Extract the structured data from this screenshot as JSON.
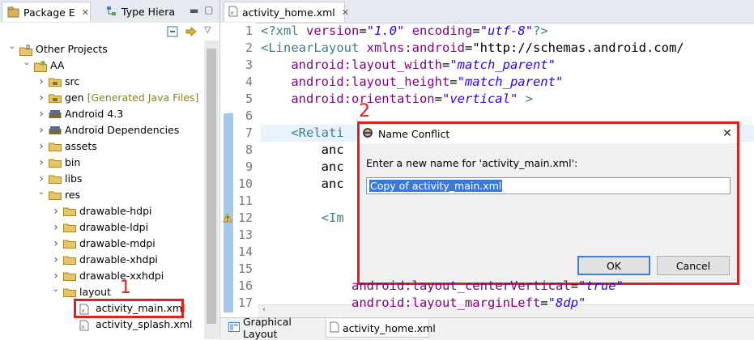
{
  "left_panel": {
    "tabs": [
      {
        "label": "Package E",
        "active": true
      },
      {
        "label": "Type Hiera",
        "active": false
      }
    ],
    "tree": [
      {
        "label": "Other Projects",
        "depth": 0,
        "expanded": true,
        "icon": "working-set-icon"
      },
      {
        "label": "AA",
        "depth": 1,
        "expanded": true,
        "icon": "android-project-icon"
      },
      {
        "label": "src",
        "depth": 2,
        "expanded": false,
        "icon": "source-folder-icon"
      },
      {
        "label": "gen",
        "suffix": "[Generated Java Files]",
        "depth": 2,
        "expanded": false,
        "icon": "source-folder-icon"
      },
      {
        "label": "Android 4.3",
        "depth": 2,
        "expanded": false,
        "icon": "library-icon"
      },
      {
        "label": "Android Dependencies",
        "depth": 2,
        "expanded": false,
        "icon": "library-icon"
      },
      {
        "label": "assets",
        "depth": 2,
        "expanded": false,
        "icon": "folder-icon"
      },
      {
        "label": "bin",
        "depth": 2,
        "expanded": false,
        "icon": "folder-icon"
      },
      {
        "label": "libs",
        "depth": 2,
        "expanded": false,
        "icon": "folder-icon"
      },
      {
        "label": "res",
        "depth": 2,
        "expanded": true,
        "icon": "folder-icon"
      },
      {
        "label": "drawable-hdpi",
        "depth": 3,
        "expanded": false,
        "icon": "folder-icon"
      },
      {
        "label": "drawable-ldpi",
        "depth": 3,
        "expanded": false,
        "icon": "folder-icon"
      },
      {
        "label": "drawable-mdpi",
        "depth": 3,
        "expanded": false,
        "icon": "folder-icon"
      },
      {
        "label": "drawable-xhdpi",
        "depth": 3,
        "expanded": false,
        "icon": "folder-icon"
      },
      {
        "label": "drawable-xxhdpi",
        "depth": 3,
        "expanded": false,
        "icon": "folder-icon"
      },
      {
        "label": "layout",
        "depth": 3,
        "expanded": true,
        "icon": "folder-icon"
      },
      {
        "label": "activity_main.xml",
        "depth": 4,
        "icon": "xml-file-icon",
        "highlighted": true
      },
      {
        "label": "activity_splash.xml",
        "depth": 4,
        "icon": "xml-file-icon"
      }
    ],
    "marker": "1"
  },
  "editor": {
    "tab_label": "activity_home.xml",
    "lines": [
      {
        "n": "1",
        "text": "<?xml version=\"1.0\" encoding=\"utf-8\"?>"
      },
      {
        "n": "2",
        "text": "<LinearLayout xmlns:android=\"http://schemas.android.com/"
      },
      {
        "n": "3",
        "text": "    android:layout_width=\"match_parent\""
      },
      {
        "n": "4",
        "text": "    android:layout_height=\"match_parent\""
      },
      {
        "n": "5",
        "text": "    android:orientation=\"vertical\" >"
      },
      {
        "n": "6",
        "text": ""
      },
      {
        "n": "7",
        "text": "    <Relati"
      },
      {
        "n": "8",
        "text": "        anc"
      },
      {
        "n": "9",
        "text": "        anc"
      },
      {
        "n": "10",
        "text": "        anc"
      },
      {
        "n": "11",
        "text": ""
      },
      {
        "n": "12",
        "text": "        <Im"
      },
      {
        "n": "13",
        "text": ""
      },
      {
        "n": "14",
        "text": ""
      },
      {
        "n": "15",
        "text": ""
      },
      {
        "n": "16",
        "text": "            android:layout_centerVertical=\"true\""
      },
      {
        "n": "17",
        "text": "            android:layout_marginLeft=\"8dp\""
      }
    ],
    "bottom_tabs": [
      {
        "label": "Graphical Layout",
        "active": false
      },
      {
        "label": "activity_home.xml",
        "active": true
      }
    ],
    "marker": "2"
  },
  "dialog": {
    "title": "Name Conflict",
    "prompt": "Enter a new name for 'activity_main.xml':",
    "input_value": "Copy of activity_main.xml",
    "ok_label": "OK",
    "cancel_label": "Cancel"
  },
  "colors": {
    "highlight_red": "#e02020",
    "selection_blue": "#3b78d8",
    "tag": "#3f7f7f",
    "attr": "#7f007f",
    "string": "#2a00ff"
  }
}
